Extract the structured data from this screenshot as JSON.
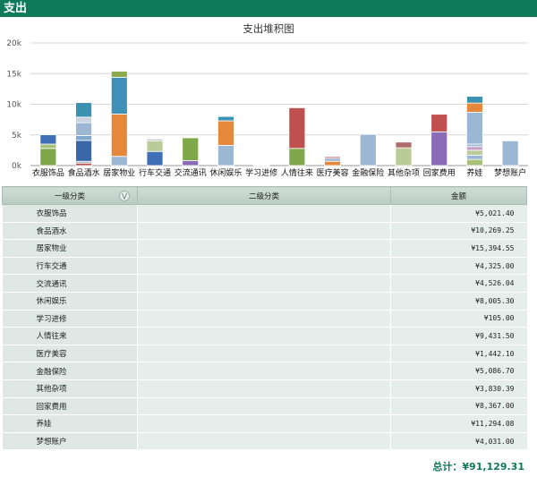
{
  "header": {
    "title": "支出"
  },
  "chart_data": {
    "type": "bar",
    "stacked": true,
    "title": "支出堆积图",
    "ylim": [
      0,
      20000
    ],
    "yticks": [
      0,
      5000,
      10000,
      15000,
      20000
    ],
    "ytick_labels": [
      "0k",
      "5k",
      "10k",
      "15k",
      "20k"
    ],
    "grid": true,
    "categories": [
      "衣服饰品",
      "食品酒水",
      "居家物业",
      "行车交通",
      "交流通讯",
      "休闲娱乐",
      "学习进修",
      "人情往来",
      "医疗美容",
      "金融保险",
      "其他杂项",
      "回家费用",
      "养娃",
      "梦想账户"
    ],
    "stacks": [
      [
        {
          "v": 2800,
          "c": "#7ea84a"
        },
        {
          "v": 700,
          "c": "#a7c07a"
        },
        {
          "v": 1521,
          "c": "#3f6fb5"
        }
      ],
      [
        {
          "v": 400,
          "c": "#c0504d"
        },
        {
          "v": 300,
          "c": "#9bb7d4"
        },
        {
          "v": 3400,
          "c": "#3a67a8"
        },
        {
          "v": 800,
          "c": "#7fa8cf"
        },
        {
          "v": 2100,
          "c": "#9bb7d4"
        },
        {
          "v": 900,
          "c": "#c8d3e0"
        },
        {
          "v": 2369,
          "c": "#3a91b0"
        }
      ],
      [
        {
          "v": 1500,
          "c": "#9bb7d4"
        },
        {
          "v": 6900,
          "c": "#e6883c"
        },
        {
          "v": 6000,
          "c": "#3e90b6"
        },
        {
          "v": 995,
          "c": "#8dab4c"
        }
      ],
      [
        {
          "v": 2300,
          "c": "#3f6fb5"
        },
        {
          "v": 1700,
          "c": "#b9cc98"
        },
        {
          "v": 325,
          "c": "#c7c7c7"
        }
      ],
      [
        {
          "v": 800,
          "c": "#8a6bb5"
        },
        {
          "v": 3726,
          "c": "#7ea84a"
        }
      ],
      [
        {
          "v": 3300,
          "c": "#9bb7d4"
        },
        {
          "v": 4000,
          "c": "#e6883c"
        },
        {
          "v": 705,
          "c": "#3a91b0"
        }
      ],
      [
        {
          "v": 105,
          "c": "#9bb7d4"
        }
      ],
      [
        {
          "v": 2800,
          "c": "#7ea84a"
        },
        {
          "v": 6631,
          "c": "#c0504d"
        }
      ],
      [
        {
          "v": 700,
          "c": "#e6883c"
        },
        {
          "v": 500,
          "c": "#9bb7d4"
        },
        {
          "v": 242,
          "c": "#c0504d"
        }
      ],
      [
        {
          "v": 5087,
          "c": "#9bb7d4"
        }
      ],
      [
        {
          "v": 2900,
          "c": "#b9cc98"
        },
        {
          "v": 930,
          "c": "#b06b6b"
        }
      ],
      [
        {
          "v": 5500,
          "c": "#8a6bb5"
        },
        {
          "v": 2867,
          "c": "#c0504d"
        }
      ],
      [
        {
          "v": 1000,
          "c": "#a7c07a"
        },
        {
          "v": 700,
          "c": "#9bb7d4"
        },
        {
          "v": 800,
          "c": "#b9cc98"
        },
        {
          "v": 600,
          "c": "#c7a0c8"
        },
        {
          "v": 400,
          "c": "#9bb7d4"
        },
        {
          "v": 5200,
          "c": "#9bb7d4"
        },
        {
          "v": 1500,
          "c": "#e6883c"
        },
        {
          "v": 1094,
          "c": "#3a91b0"
        }
      ],
      [
        {
          "v": 4031,
          "c": "#9bb7d4"
        }
      ]
    ]
  },
  "table": {
    "headers": {
      "level1": "一级分类",
      "level2": "二级分类",
      "amount": "金额"
    },
    "rows": [
      {
        "cat": "衣服饰品",
        "amount": "¥5,021.40"
      },
      {
        "cat": "食品酒水",
        "amount": "¥10,269.25"
      },
      {
        "cat": "居家物业",
        "amount": "¥15,394.55"
      },
      {
        "cat": "行车交通",
        "amount": "¥4,325.00"
      },
      {
        "cat": "交流通讯",
        "amount": "¥4,526.04"
      },
      {
        "cat": "休闲娱乐",
        "amount": "¥8,005.30"
      },
      {
        "cat": "学习进修",
        "amount": "¥105.00"
      },
      {
        "cat": "人情往来",
        "amount": "¥9,431.50"
      },
      {
        "cat": "医疗美容",
        "amount": "¥1,442.10"
      },
      {
        "cat": "金融保险",
        "amount": "¥5,086.70"
      },
      {
        "cat": "其他杂项",
        "amount": "¥3,830.39"
      },
      {
        "cat": "回家费用",
        "amount": "¥8,367.00"
      },
      {
        "cat": "养娃",
        "amount": "¥11,294.08"
      },
      {
        "cat": "梦想账户",
        "amount": "¥4,031.00"
      }
    ]
  },
  "total": {
    "text": "总计：¥91,129.31"
  }
}
